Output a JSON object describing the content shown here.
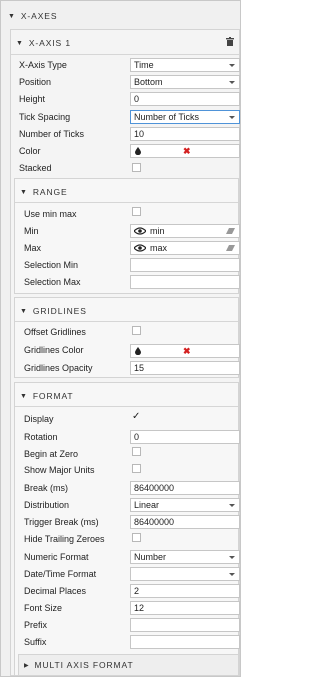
{
  "x_axes": {
    "header": "X-AXES",
    "x_axis_1": {
      "header": "X-AXIS 1",
      "x_axis_type": {
        "label": "X-Axis Type",
        "value": "Time"
      },
      "position": {
        "label": "Position",
        "value": "Bottom"
      },
      "height": {
        "label": "Height",
        "value": "0"
      },
      "tick_spacing": {
        "label": "Tick Spacing",
        "value": "Number of Ticks"
      },
      "number_of_ticks": {
        "label": "Number of Ticks",
        "value": "10"
      },
      "color": {
        "label": "Color",
        "value_icon": "x-mark-icon",
        "color_hex": "#d42020"
      },
      "stacked": {
        "label": "Stacked",
        "checked": false
      }
    },
    "range": {
      "header": "RANGE",
      "use_min_max": {
        "label": "Use min max",
        "checked": false
      },
      "min": {
        "label": "Min",
        "value": "min"
      },
      "max": {
        "label": "Max",
        "value": "max"
      },
      "selection_min": {
        "label": "Selection Min",
        "value": ""
      },
      "selection_max": {
        "label": "Selection Max",
        "value": ""
      }
    },
    "gridlines": {
      "header": "GRIDLINES",
      "offset_gridlines": {
        "label": "Offset Gridlines",
        "checked": false
      },
      "gridlines_color": {
        "label": "Gridlines Color",
        "value_icon": "x-mark-icon"
      },
      "gridlines_opacity": {
        "label": "Gridlines Opacity",
        "value": "15"
      }
    },
    "format": {
      "header": "FORMAT",
      "display": {
        "label": "Display",
        "checked": true
      },
      "rotation": {
        "label": "Rotation",
        "value": "0"
      },
      "begin_at_zero": {
        "label": "Begin at Zero",
        "checked": false
      },
      "show_major_units": {
        "label": "Show Major Units",
        "checked": false
      },
      "break_ms": {
        "label": "Break (ms)",
        "value": "86400000"
      },
      "distribution": {
        "label": "Distribution",
        "value": "Linear"
      },
      "trigger_break_ms": {
        "label": "Trigger Break (ms)",
        "value": "86400000"
      },
      "hide_trailing_zeroes": {
        "label": "Hide Trailing Zeroes",
        "checked": false
      },
      "numeric_format": {
        "label": "Numeric Format",
        "value": "Number"
      },
      "date_time_format": {
        "label": "Date/Time Format",
        "value": ""
      },
      "decimal_places": {
        "label": "Decimal Places",
        "value": "2"
      },
      "font_size": {
        "label": "Font Size",
        "value": "12"
      },
      "prefix": {
        "label": "Prefix",
        "value": ""
      },
      "suffix": {
        "label": "Suffix",
        "value": ""
      },
      "multi_axis_format": {
        "header": "MULTI AXIS FORMAT"
      }
    }
  }
}
